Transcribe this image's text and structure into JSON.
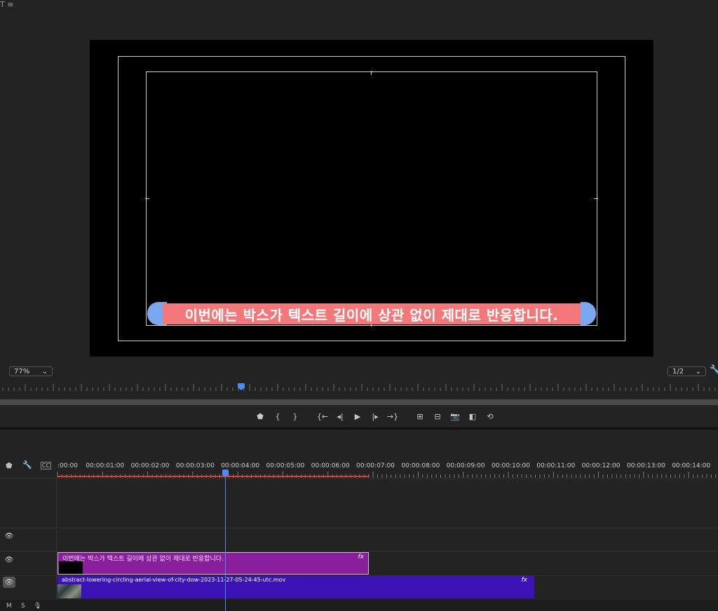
{
  "app": {
    "menu_glyphs": "T  ≡"
  },
  "monitor": {
    "caption_text": "이번에는 박스가 텍스트 길이에 상관 없이 제대로 반응합니다.",
    "zoom_level": "77%",
    "resolution": "1/2",
    "playhead_fraction": 0.335,
    "colors": {
      "caption_box": "#f4777a",
      "caption_ends": "#7aa8f0",
      "caption_text": "#ffffff"
    }
  },
  "transport": {
    "buttons": [
      {
        "name": "add-marker-button",
        "glyph": "⬟"
      },
      {
        "name": "mark-in-button",
        "glyph": "{"
      },
      {
        "name": "mark-out-button",
        "glyph": "}"
      },
      {
        "name": "go-to-in-button",
        "glyph": "{←"
      },
      {
        "name": "step-back-button",
        "glyph": "◂|"
      },
      {
        "name": "play-button",
        "glyph": "▶"
      },
      {
        "name": "step-forward-button",
        "glyph": "|▸"
      },
      {
        "name": "go-to-out-button",
        "glyph": "→}"
      },
      {
        "name": "lift-button",
        "glyph": "⊞"
      },
      {
        "name": "extract-button",
        "glyph": "⊟"
      },
      {
        "name": "export-frame-button",
        "glyph": "📷"
      },
      {
        "name": "comparison-view-button",
        "glyph": "◧"
      },
      {
        "name": "toggle-proxies-button",
        "glyph": "⟲"
      }
    ]
  },
  "timeline": {
    "timecodes": [
      ":00:00",
      "00:00:01:00",
      "00:00:02:00",
      "00:00:03:00",
      "00:00:04:00",
      "00:00:05:00",
      "00:00:06:00",
      "00:00:07:00",
      "00:00:08:00",
      "00:00:09:00",
      "00:00:10:00",
      "00:00:11:00",
      "00:00:12:00",
      "00:00:13:00",
      "00:00:14:00"
    ],
    "header_tools": {
      "marker": "⬟",
      "wrench": "🔧",
      "cc": "CC"
    },
    "clips": {
      "title_clip": {
        "label": "이번에는 박스가 텍스트 길이에 상관 없이 제대로 반응합니다.",
        "fx": "fx"
      },
      "video_clip": {
        "label": "abstract-lowering-circling-aerial-view-of-city-dow-2023-11-27-05-24-45-utc.mov",
        "fx": "fx"
      }
    },
    "bottom_controls": {
      "mute": "M",
      "solo": "S",
      "mic": "🎙"
    },
    "eye_glyph": "👁"
  }
}
